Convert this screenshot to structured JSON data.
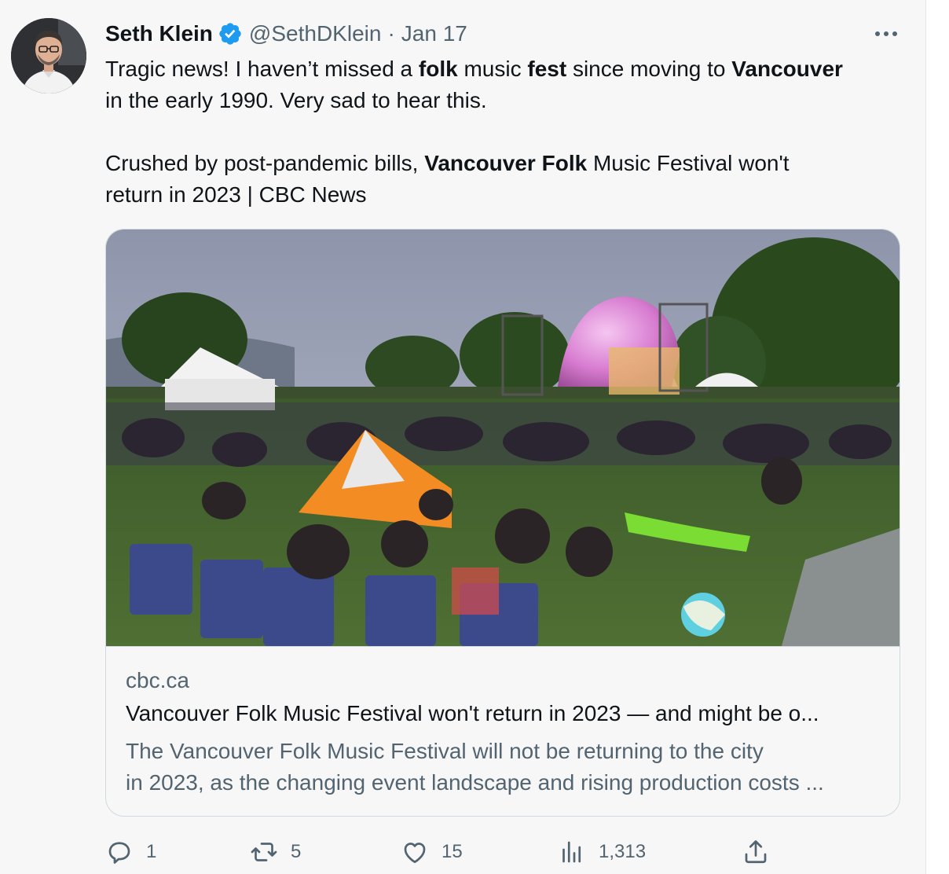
{
  "tweet": {
    "author_name": "Seth Klein",
    "handle": "@SethDKlein",
    "separator": "·",
    "date": "Jan 17",
    "text_lines": [
      [
        {
          "t": "Tragic news! I haven’t missed a ",
          "b": false
        },
        {
          "t": "folk",
          "b": true
        },
        {
          "t": " music ",
          "b": false
        },
        {
          "t": "fest",
          "b": true
        },
        {
          "t": " since moving to ",
          "b": false
        },
        {
          "t": "Vancouver",
          "b": true
        }
      ],
      [
        {
          "t": "in the early 1990. Very sad to hear this.",
          "b": false
        }
      ],
      [],
      [
        {
          "t": "Crushed by post-pandemic bills, ",
          "b": false
        },
        {
          "t": "Vancouver Folk",
          "b": true
        },
        {
          "t": " Music Festival won't",
          "b": false
        }
      ],
      [
        {
          "t": "return in 2023 | CBC News",
          "b": false
        }
      ]
    ]
  },
  "card": {
    "domain": "cbc.ca",
    "title": "Vancouver Folk Music Festival won't return in 2023 — and might be o...",
    "description_line1": "The Vancouver Folk Music Festival will not be returning to the city",
    "description_line2": "in 2023, as the changing event landscape and rising production costs ..."
  },
  "actions": {
    "replies": "1",
    "retweets": "5",
    "likes": "15",
    "views": "1,313"
  },
  "icons": {
    "verified": "verified-badge-icon",
    "more": "more-options-icon",
    "reply": "reply-icon",
    "retweet": "retweet-icon",
    "like": "heart-icon",
    "views": "views-icon",
    "share": "share-icon"
  },
  "colors": {
    "text": "#0f1419",
    "secondary": "#536471",
    "verified": "#1d9bf0",
    "border": "#cfd9de",
    "background": "#f7f7f7"
  }
}
